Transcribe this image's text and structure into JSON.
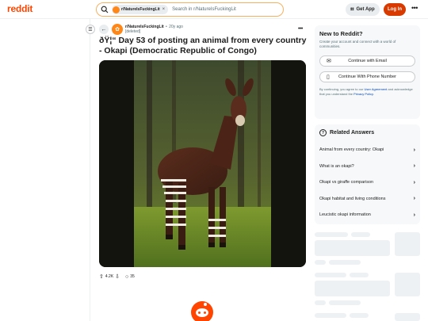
{
  "header": {
    "logo": "reddit",
    "chip_label": "r/NatureIsFuckingLit",
    "chip_close": "×",
    "search_placeholder": "Search in r/NatureIsFuckingLit",
    "get_app_label": "Get App",
    "login_label": "Log In",
    "more_label": "•••"
  },
  "post": {
    "subreddit": "r/NatureIsFuckingLit",
    "separator": "•",
    "age": "20y ago",
    "author": "[deleted]",
    "title": "ðŸ¦“ Day 53 of posting an animal from every country - Okapi (Democratic Republic of Congo)",
    "image_subject": "okapi standing in forest",
    "votes": "4.2K",
    "comments": "35",
    "overflow_label": "•••"
  },
  "sidebar": {
    "new_title": "New to Reddit?",
    "new_subtitle": "Create your account and connect with a world of communities.",
    "email_button": "Continue with Email",
    "phone_button": "Continue With Phone Number",
    "terms_prefix": "By continuing, you agree to our",
    "terms_user_agreement": "User Agreement",
    "terms_middle": "and acknowledge that you understand the",
    "terms_privacy": "Privacy Policy",
    "terms_suffix": "."
  },
  "related": {
    "title": "Related Answers",
    "items": [
      {
        "label": "Animal from every country: Okapi"
      },
      {
        "label": "What is an okapi?"
      },
      {
        "label": "Okapi vs giraffe comparison"
      },
      {
        "label": "Okapi habitat and living conditions"
      },
      {
        "label": "Leucistic okapi information"
      }
    ]
  },
  "colors": {
    "brand": "#ff4500",
    "login": "#d93a00",
    "search_border": "#f6b060",
    "link": "#0045ac"
  },
  "icons": {
    "search": "search-icon",
    "get_app": "qr-code-icon",
    "back": "arrow-left-icon",
    "menu": "hamburger-icon",
    "upvote": "upvote-icon",
    "downvote": "downvote-icon",
    "comment": "comment-bubble-icon",
    "email": "mail-icon",
    "phone": "phone-icon",
    "related": "answers-icon",
    "chevron": "chevron-right-icon"
  }
}
